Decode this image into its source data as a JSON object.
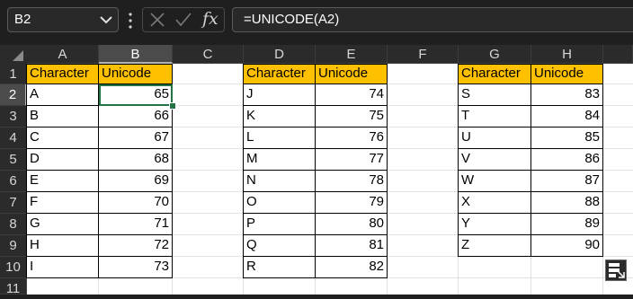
{
  "formula_bar": {
    "name_box": "B2",
    "formula": "=UNICODE(A2)",
    "fx_label": "fx"
  },
  "columns": [
    "A",
    "B",
    "C",
    "D",
    "E",
    "F",
    "G",
    "H"
  ],
  "selected_column": "B",
  "rows": [
    "1",
    "2",
    "3",
    "4",
    "5",
    "6",
    "7",
    "8",
    "9",
    "10",
    "11"
  ],
  "selected_row": "2",
  "headers": {
    "character": "Character",
    "unicode": "Unicode"
  },
  "table1": [
    {
      "c": "A",
      "v": "65"
    },
    {
      "c": "B",
      "v": "66"
    },
    {
      "c": "C",
      "v": "67"
    },
    {
      "c": "D",
      "v": "68"
    },
    {
      "c": "E",
      "v": "69"
    },
    {
      "c": "F",
      "v": "70"
    },
    {
      "c": "G",
      "v": "71"
    },
    {
      "c": "H",
      "v": "72"
    },
    {
      "c": "I",
      "v": "73"
    }
  ],
  "table2": [
    {
      "c": "J",
      "v": "74"
    },
    {
      "c": "K",
      "v": "75"
    },
    {
      "c": "L",
      "v": "76"
    },
    {
      "c": "M",
      "v": "77"
    },
    {
      "c": "N",
      "v": "78"
    },
    {
      "c": "O",
      "v": "79"
    },
    {
      "c": "P",
      "v": "80"
    },
    {
      "c": "Q",
      "v": "81"
    },
    {
      "c": "R",
      "v": "82"
    }
  ],
  "table3": [
    {
      "c": "S",
      "v": "83"
    },
    {
      "c": "T",
      "v": "84"
    },
    {
      "c": "U",
      "v": "85"
    },
    {
      "c": "V",
      "v": "86"
    },
    {
      "c": "W",
      "v": "87"
    },
    {
      "c": "X",
      "v": "88"
    },
    {
      "c": "Y",
      "v": "89"
    },
    {
      "c": "Z",
      "v": "90"
    }
  ],
  "colors": {
    "header_fill": "#ffc000",
    "selection": "#217346"
  }
}
